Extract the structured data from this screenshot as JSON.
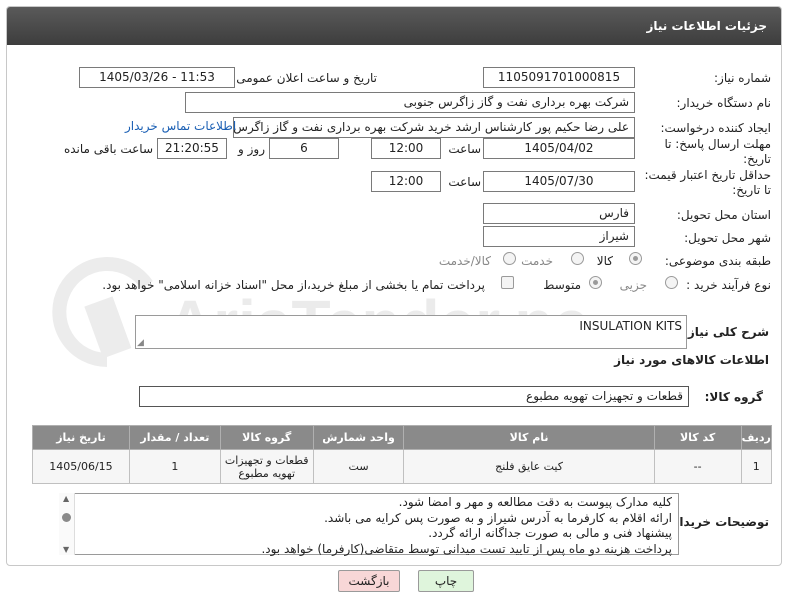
{
  "panel": {
    "title": "جزئیات اطلاعات نیاز"
  },
  "form": {
    "need_number": {
      "label": "شماره نیاز:",
      "value": "1105091701000815"
    },
    "announce_date": {
      "label": "تاریخ و ساعت اعلان عمومی:",
      "value": "1405/03/26 - 11:53"
    },
    "buyer_org": {
      "label": "نام دستگاه خریدار:",
      "value": "شرکت بهره برداری نفت و گاز زاگرس جنوبی"
    },
    "requester": {
      "label": "ایجاد کننده درخواست:",
      "value": "علی رضا حکیم پور کارشناس ارشد خرید شرکت بهره برداری نفت و گاز زاگرس ج",
      "contact_link": "اطلاعات تماس خریدار"
    },
    "reply_deadline": {
      "label_line1": "مهلت ارسال پاسخ: تا",
      "label_line2": "تاریخ:",
      "date": "1405/04/02",
      "time_label": "ساعت",
      "time": "12:00",
      "days": "6",
      "days_label": "روز و",
      "remaining": "21:20:55",
      "remaining_label": "ساعت باقی مانده"
    },
    "price_validity": {
      "label_line1": "حداقل تاریخ اعتبار قیمت:",
      "label_line2": "تا تاریخ:",
      "date": "1405/07/30",
      "time_label": "ساعت",
      "time": "12:00"
    },
    "province": {
      "label": "استان محل تحویل:",
      "value": "فارس"
    },
    "city": {
      "label": "شهر محل تحویل:",
      "value": "شیراز"
    },
    "category": {
      "label": "طبقه بندی موضوعی:",
      "options": [
        "کالا",
        "خدمت",
        "کالا/خدمت"
      ],
      "selected": "کالا"
    },
    "process_type": {
      "label": "نوع فرآیند خرید :",
      "options": [
        "جزیی",
        "متوسط"
      ],
      "selected": "متوسط",
      "payment_note": "پرداخت تمام یا بخشی از مبلغ خرید،از محل \"اسناد خزانه اسلامی\" خواهد بود."
    }
  },
  "description": {
    "label": "شرح کلی نیاز:",
    "value": "INSULATION KITS"
  },
  "goods_section": {
    "title": "اطلاعات کالاهای مورد نیاز",
    "group_label": "گروه کالا:",
    "group_value": "قطعات و تجهیزات تهویه مطبوع"
  },
  "table": {
    "headers": [
      "ردیف",
      "کد کالا",
      "نام کالا",
      "واحد شمارش",
      "گروه کالا",
      "تعداد / مقدار",
      "تاریخ نیاز"
    ],
    "rows": [
      {
        "row": "1",
        "code": "--",
        "name": "کیت عایق فلنج",
        "unit": "ست",
        "group_line1": "قطعات و تجهیزات",
        "group_line2": "تهویه مطبوع",
        "qty": "1",
        "date": "1405/06/15"
      }
    ]
  },
  "buyer_notes": {
    "label": "توضیحات خریدار:",
    "lines": [
      "کلیه مدارک پیوست به دقت مطالعه و مهر و امضا شود.",
      "ارائه اقلام به کارفرما به آدرس شیراز و به صورت پس کرایه می باشد.",
      "پیشنهاد فنی و مالی به صورت جداگانه ارائه گردد.",
      "پرداخت هزینه دو ماه پس از تایید تست میدانی  توسط متقاضی(کارفرما) خواهد بود."
    ]
  },
  "buttons": {
    "print": "چاپ",
    "back": "بازگشت"
  },
  "watermark": {
    "text": "AriaTender.neT"
  },
  "colors": {
    "header_bg": "#4a4a4a",
    "table_header_bg": "#8a8a8a",
    "link": "#1a5fb4",
    "print_btn": "#dff5dc",
    "back_btn": "#f8d7d7",
    "watermark": "#e7e7e7"
  }
}
